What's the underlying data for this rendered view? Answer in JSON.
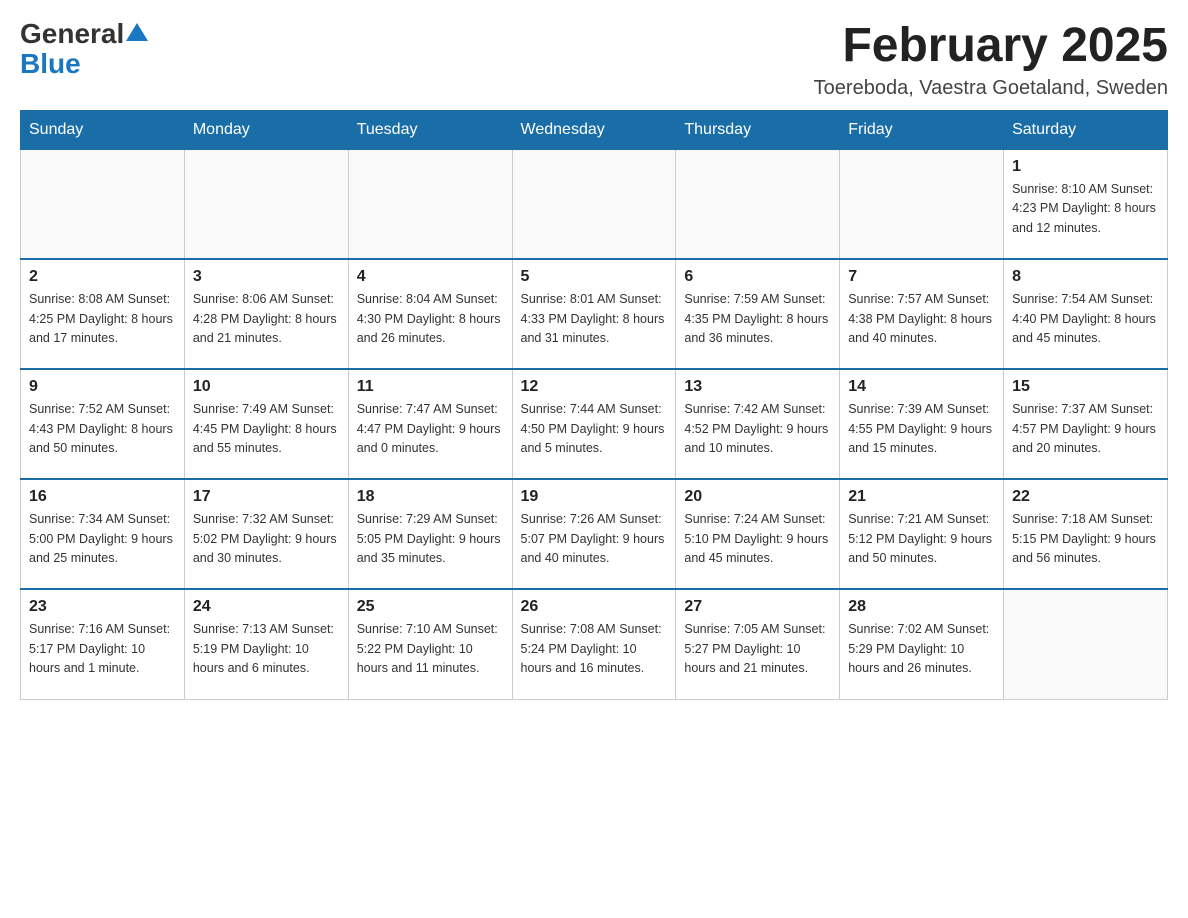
{
  "header": {
    "logo_general": "General",
    "logo_blue": "Blue",
    "month_title": "February 2025",
    "location": "Toereboda, Vaestra Goetaland, Sweden"
  },
  "days_of_week": [
    "Sunday",
    "Monday",
    "Tuesday",
    "Wednesday",
    "Thursday",
    "Friday",
    "Saturday"
  ],
  "weeks": [
    [
      {
        "day": "",
        "info": ""
      },
      {
        "day": "",
        "info": ""
      },
      {
        "day": "",
        "info": ""
      },
      {
        "day": "",
        "info": ""
      },
      {
        "day": "",
        "info": ""
      },
      {
        "day": "",
        "info": ""
      },
      {
        "day": "1",
        "info": "Sunrise: 8:10 AM\nSunset: 4:23 PM\nDaylight: 8 hours and 12 minutes."
      }
    ],
    [
      {
        "day": "2",
        "info": "Sunrise: 8:08 AM\nSunset: 4:25 PM\nDaylight: 8 hours and 17 minutes."
      },
      {
        "day": "3",
        "info": "Sunrise: 8:06 AM\nSunset: 4:28 PM\nDaylight: 8 hours and 21 minutes."
      },
      {
        "day": "4",
        "info": "Sunrise: 8:04 AM\nSunset: 4:30 PM\nDaylight: 8 hours and 26 minutes."
      },
      {
        "day": "5",
        "info": "Sunrise: 8:01 AM\nSunset: 4:33 PM\nDaylight: 8 hours and 31 minutes."
      },
      {
        "day": "6",
        "info": "Sunrise: 7:59 AM\nSunset: 4:35 PM\nDaylight: 8 hours and 36 minutes."
      },
      {
        "day": "7",
        "info": "Sunrise: 7:57 AM\nSunset: 4:38 PM\nDaylight: 8 hours and 40 minutes."
      },
      {
        "day": "8",
        "info": "Sunrise: 7:54 AM\nSunset: 4:40 PM\nDaylight: 8 hours and 45 minutes."
      }
    ],
    [
      {
        "day": "9",
        "info": "Sunrise: 7:52 AM\nSunset: 4:43 PM\nDaylight: 8 hours and 50 minutes."
      },
      {
        "day": "10",
        "info": "Sunrise: 7:49 AM\nSunset: 4:45 PM\nDaylight: 8 hours and 55 minutes."
      },
      {
        "day": "11",
        "info": "Sunrise: 7:47 AM\nSunset: 4:47 PM\nDaylight: 9 hours and 0 minutes."
      },
      {
        "day": "12",
        "info": "Sunrise: 7:44 AM\nSunset: 4:50 PM\nDaylight: 9 hours and 5 minutes."
      },
      {
        "day": "13",
        "info": "Sunrise: 7:42 AM\nSunset: 4:52 PM\nDaylight: 9 hours and 10 minutes."
      },
      {
        "day": "14",
        "info": "Sunrise: 7:39 AM\nSunset: 4:55 PM\nDaylight: 9 hours and 15 minutes."
      },
      {
        "day": "15",
        "info": "Sunrise: 7:37 AM\nSunset: 4:57 PM\nDaylight: 9 hours and 20 minutes."
      }
    ],
    [
      {
        "day": "16",
        "info": "Sunrise: 7:34 AM\nSunset: 5:00 PM\nDaylight: 9 hours and 25 minutes."
      },
      {
        "day": "17",
        "info": "Sunrise: 7:32 AM\nSunset: 5:02 PM\nDaylight: 9 hours and 30 minutes."
      },
      {
        "day": "18",
        "info": "Sunrise: 7:29 AM\nSunset: 5:05 PM\nDaylight: 9 hours and 35 minutes."
      },
      {
        "day": "19",
        "info": "Sunrise: 7:26 AM\nSunset: 5:07 PM\nDaylight: 9 hours and 40 minutes."
      },
      {
        "day": "20",
        "info": "Sunrise: 7:24 AM\nSunset: 5:10 PM\nDaylight: 9 hours and 45 minutes."
      },
      {
        "day": "21",
        "info": "Sunrise: 7:21 AM\nSunset: 5:12 PM\nDaylight: 9 hours and 50 minutes."
      },
      {
        "day": "22",
        "info": "Sunrise: 7:18 AM\nSunset: 5:15 PM\nDaylight: 9 hours and 56 minutes."
      }
    ],
    [
      {
        "day": "23",
        "info": "Sunrise: 7:16 AM\nSunset: 5:17 PM\nDaylight: 10 hours and 1 minute."
      },
      {
        "day": "24",
        "info": "Sunrise: 7:13 AM\nSunset: 5:19 PM\nDaylight: 10 hours and 6 minutes."
      },
      {
        "day": "25",
        "info": "Sunrise: 7:10 AM\nSunset: 5:22 PM\nDaylight: 10 hours and 11 minutes."
      },
      {
        "day": "26",
        "info": "Sunrise: 7:08 AM\nSunset: 5:24 PM\nDaylight: 10 hours and 16 minutes."
      },
      {
        "day": "27",
        "info": "Sunrise: 7:05 AM\nSunset: 5:27 PM\nDaylight: 10 hours and 21 minutes."
      },
      {
        "day": "28",
        "info": "Sunrise: 7:02 AM\nSunset: 5:29 PM\nDaylight: 10 hours and 26 minutes."
      },
      {
        "day": "",
        "info": ""
      }
    ]
  ]
}
